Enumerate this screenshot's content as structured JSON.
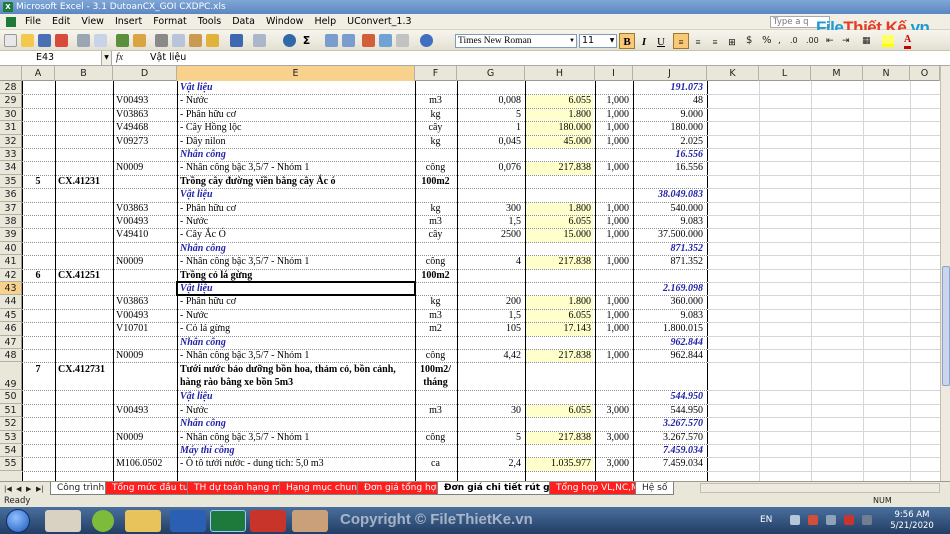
{
  "window": {
    "title": "Microsoft Excel - 3.1 DutoanCX_GOI CXDPC.xls"
  },
  "menu": [
    "File",
    "Edit",
    "View",
    "Insert",
    "Format",
    "Tools",
    "Data",
    "Window",
    "Help",
    "UConvert_1.3"
  ],
  "help_placeholder": "Type a q",
  "logo": {
    "part1": "File",
    "part2": "Thiết Kế",
    "part3": ".vn"
  },
  "format": {
    "font": "Times New Roman",
    "size": "11",
    "bold": "B",
    "italic": "I",
    "underline": "U"
  },
  "formula_bar": {
    "name_box": "E43",
    "fx": "fx",
    "value": "Vật liệu"
  },
  "columns": [
    "A",
    "B",
    "D",
    "E",
    "F",
    "G",
    "H",
    "I",
    "J",
    "K",
    "L",
    "M",
    "N",
    "O"
  ],
  "rows": [
    {
      "n": "28",
      "a": "",
      "b": "",
      "d": "",
      "e": "Vật liệu",
      "f": "",
      "g": "",
      "h": "",
      "i": "",
      "j": "191.073",
      "style": "bi"
    },
    {
      "n": "29",
      "a": "",
      "b": "",
      "d": "V00493",
      "e": "- Nước",
      "f": "m3",
      "g": "0,008",
      "h": "6.055",
      "i": "1,000",
      "j": "48"
    },
    {
      "n": "30",
      "a": "",
      "b": "",
      "d": "V03863",
      "e": "- Phân hữu cơ",
      "f": "kg",
      "g": "5",
      "h": "1.800",
      "i": "1,000",
      "j": "9.000"
    },
    {
      "n": "31",
      "a": "",
      "b": "",
      "d": "V49468",
      "e": "- Cây Hồng lộc",
      "f": "cây",
      "g": "1",
      "h": "180.000",
      "i": "1,000",
      "j": "180.000"
    },
    {
      "n": "32",
      "a": "",
      "b": "",
      "d": "V09273",
      "e": "- Dây nilon",
      "f": "kg",
      "g": "0,045",
      "h": "45.000",
      "i": "1,000",
      "j": "2.025"
    },
    {
      "n": "33",
      "a": "",
      "b": "",
      "d": "",
      "e": "Nhân công",
      "f": "",
      "g": "",
      "h": "",
      "i": "",
      "j": "16.556",
      "style": "bi"
    },
    {
      "n": "34",
      "a": "",
      "b": "",
      "d": "N0009",
      "e": "- Nhân công bậc 3,5/7 - Nhóm 1",
      "f": "công",
      "g": "0,076",
      "h": "217.838",
      "i": "1,000",
      "j": "16.556"
    },
    {
      "n": "35",
      "a": "5",
      "b": "CX.41231",
      "d": "",
      "e": "Trồng cây đường viền bằng cây Ắc ó",
      "f": "100m2",
      "g": "",
      "h": "",
      "i": "",
      "j": "",
      "style": "b"
    },
    {
      "n": "36",
      "a": "",
      "b": "",
      "d": "",
      "e": "Vật liệu",
      "f": "",
      "g": "",
      "h": "",
      "i": "",
      "j": "38.049.083",
      "style": "bi"
    },
    {
      "n": "37",
      "a": "",
      "b": "",
      "d": "V03863",
      "e": "- Phân hữu cơ",
      "f": "kg",
      "g": "300",
      "h": "1.800",
      "i": "1,000",
      "j": "540.000"
    },
    {
      "n": "38",
      "a": "",
      "b": "",
      "d": "V00493",
      "e": "- Nước",
      "f": "m3",
      "g": "1,5",
      "h": "6.055",
      "i": "1,000",
      "j": "9.083"
    },
    {
      "n": "39",
      "a": "",
      "b": "",
      "d": "V49410",
      "e": "- Cây Ắc Ó",
      "f": "cây",
      "g": "2500",
      "h": "15.000",
      "i": "1,000",
      "j": "37.500.000"
    },
    {
      "n": "40",
      "a": "",
      "b": "",
      "d": "",
      "e": "Nhân công",
      "f": "",
      "g": "",
      "h": "",
      "i": "",
      "j": "871.352",
      "style": "bi"
    },
    {
      "n": "41",
      "a": "",
      "b": "",
      "d": "N0009",
      "e": "- Nhân công bậc 3,5/7 - Nhóm 1",
      "f": "công",
      "g": "4",
      "h": "217.838",
      "i": "1,000",
      "j": "871.352"
    },
    {
      "n": "42",
      "a": "6",
      "b": "CX.41251",
      "d": "",
      "e": "Trồng cỏ lá gừng",
      "f": "100m2",
      "g": "",
      "h": "",
      "i": "",
      "j": "",
      "style": "b"
    },
    {
      "n": "43",
      "a": "",
      "b": "",
      "d": "",
      "e": "Vật liệu",
      "f": "",
      "g": "",
      "h": "",
      "i": "",
      "j": "2.169.098",
      "style": "bi"
    },
    {
      "n": "44",
      "a": "",
      "b": "",
      "d": "V03863",
      "e": "- Phân hữu cơ",
      "f": "kg",
      "g": "200",
      "h": "1.800",
      "i": "1,000",
      "j": "360.000"
    },
    {
      "n": "45",
      "a": "",
      "b": "",
      "d": "V00493",
      "e": "- Nước",
      "f": "m3",
      "g": "1,5",
      "h": "6.055",
      "i": "1,000",
      "j": "9.083"
    },
    {
      "n": "46",
      "a": "",
      "b": "",
      "d": "V10701",
      "e": "- Cỏ lá gừng",
      "f": "m2",
      "g": "105",
      "h": "17.143",
      "i": "1,000",
      "j": "1.800.015"
    },
    {
      "n": "47",
      "a": "",
      "b": "",
      "d": "",
      "e": "Nhân công",
      "f": "",
      "g": "",
      "h": "",
      "i": "",
      "j": "962.844",
      "style": "bi"
    },
    {
      "n": "48",
      "a": "",
      "b": "",
      "d": "N0009",
      "e": "- Nhân công bậc 3,5/7 - Nhóm 1",
      "f": "công",
      "g": "4,42",
      "h": "217.838",
      "i": "1,000",
      "j": "962.844"
    },
    {
      "n": "49",
      "a": "7",
      "b": "CX.412731",
      "d": "",
      "e": "Tưới nước bảo dưỡng bồn hoa, thảm cỏ, bồn cảnh, hàng rào bằng xe bồn 5m3",
      "f": "100m2/ tháng",
      "g": "",
      "h": "",
      "i": "",
      "j": "",
      "style": "b",
      "tall": true
    },
    {
      "n": "50",
      "a": "",
      "b": "",
      "d": "",
      "e": "Vật liệu",
      "f": "",
      "g": "",
      "h": "",
      "i": "",
      "j": "544.950",
      "style": "bi"
    },
    {
      "n": "51",
      "a": "",
      "b": "",
      "d": "V00493",
      "e": "- Nước",
      "f": "m3",
      "g": "30",
      "h": "6.055",
      "i": "3,000",
      "j": "544.950"
    },
    {
      "n": "52",
      "a": "",
      "b": "",
      "d": "",
      "e": "Nhân công",
      "f": "",
      "g": "",
      "h": "",
      "i": "",
      "j": "3.267.570",
      "style": "bi"
    },
    {
      "n": "53",
      "a": "",
      "b": "",
      "d": "N0009",
      "e": "- Nhân công bậc 3,5/7 - Nhóm 1",
      "f": "công",
      "g": "5",
      "h": "217.838",
      "i": "3,000",
      "j": "3.267.570"
    },
    {
      "n": "54",
      "a": "",
      "b": "",
      "d": "",
      "e": "Máy thi công",
      "f": "",
      "g": "",
      "h": "",
      "i": "",
      "j": "7.459.034",
      "style": "bi"
    },
    {
      "n": "55",
      "a": "",
      "b": "",
      "d": "M106.0502",
      "e": "- Ô tô tưới nước - dung tích: 5,0 m3",
      "f": "ca",
      "g": "2,4",
      "h": "1.035.977",
      "i": "3,000",
      "j": "7.459.034"
    }
  ],
  "sheet_tabs": [
    {
      "label": "Công trình",
      "kind": "normal"
    },
    {
      "label": "Tổng mức đầu tư",
      "kind": "red"
    },
    {
      "label": "TH dự toán hạng mục",
      "kind": "red"
    },
    {
      "label": "Hạng mục chung",
      "kind": "red"
    },
    {
      "label": "Đơn giá tổng hợp",
      "kind": "red"
    },
    {
      "label": "Đơn giá chi tiết rút gọn",
      "kind": "active"
    },
    {
      "label": "Tổng hợp VL,NC,M",
      "kind": "red"
    },
    {
      "label": "Hệ số",
      "kind": "normal"
    }
  ],
  "status": {
    "left": "Ready",
    "num": "NUM"
  },
  "taskbar": {
    "watermark": "Copyright © FileThietKe.vn",
    "lang": "EN",
    "time": "9:56 AM",
    "date": "5/21/2020"
  },
  "colors": {
    "excel_green": "#1e7a3a",
    "highlight_yellow": "#ffffcc",
    "tab_red": "#ff1f1f",
    "subtotal_blue": "#1f1fa8"
  }
}
